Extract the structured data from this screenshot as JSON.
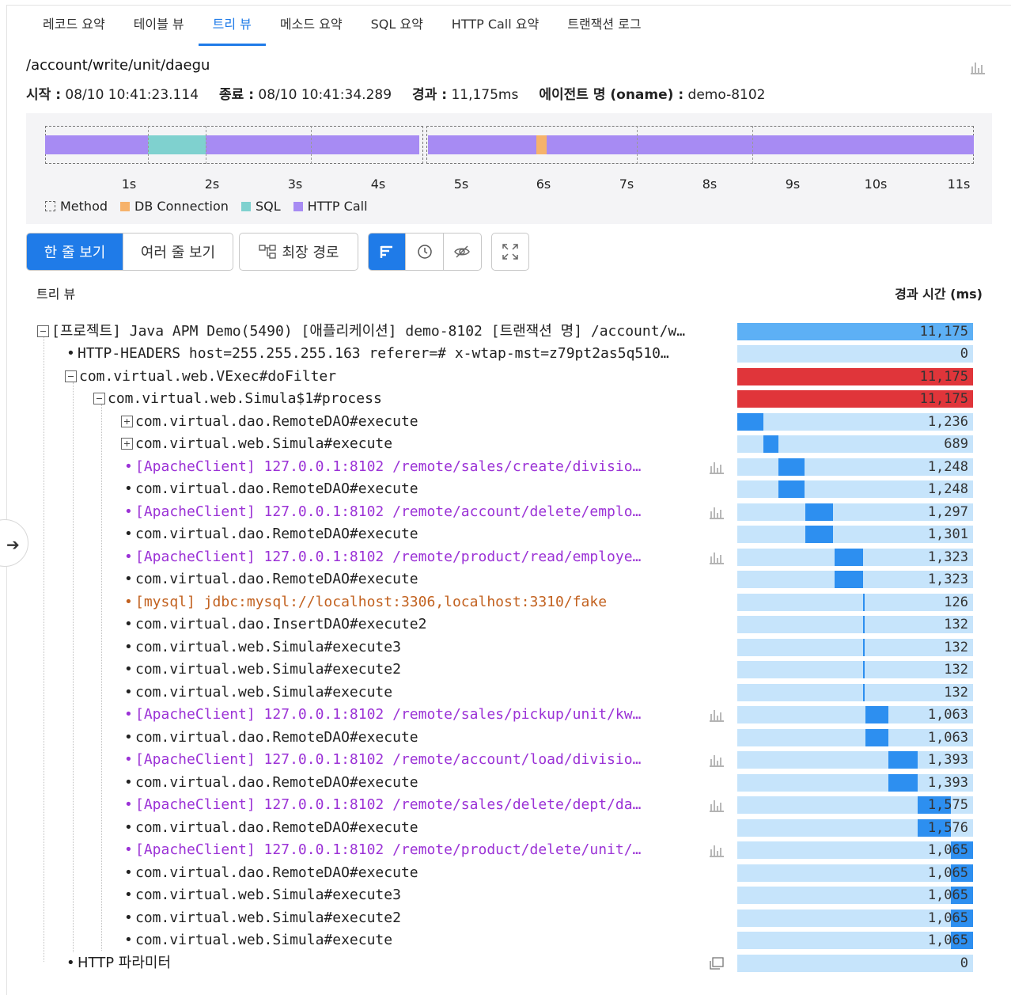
{
  "tabs": [
    "레코드 요약",
    "테이블 뷰",
    "트리 뷰",
    "메소드 요약",
    "SQL 요약",
    "HTTP Call 요약",
    "트랜잭션 로그"
  ],
  "active_tab": "트리 뷰",
  "url": "/account/write/unit/daegu",
  "meta": {
    "start_label": "시작 :",
    "start": "08/10 10:41:23.114",
    "end_label": "종료 :",
    "end": "08/10 10:41:34.289",
    "elapsed_label": "경과 :",
    "elapsed": "11,175ms",
    "agent_label": "에이전트 명 (oname) :",
    "agent": "demo-8102"
  },
  "timeline": {
    "ticks": [
      "1s",
      "2s",
      "3s",
      "4s",
      "5s",
      "6s",
      "7s",
      "8s",
      "9s",
      "10s",
      "11s"
    ],
    "legend": {
      "method": "Method",
      "db": "DB Connection",
      "sql": "SQL",
      "http": "HTTP Call"
    },
    "colors": {
      "http": "#a78bf3",
      "sql": "#7fd1cf",
      "db": "#f6b26b"
    }
  },
  "toolbar": {
    "single_line": "한 줄 보기",
    "multi_line": "여러 줄 보기",
    "longest_path": "최장 경로"
  },
  "tree_label": "트리 뷰",
  "elapsed_header": "경과 시간 (ms)",
  "rows": [
    {
      "text": "[프로젝트] Java APM Demo(5490) [애플리케이션] demo-8102 [트랜잭션 명] /account/w…",
      "value": "11,175"
    },
    {
      "text": "HTTP-HEADERS host=255.255.255.163 referer=# x-wtap-mst=z79pt2as5q510…",
      "value": "0"
    },
    {
      "text": "com.virtual.web.VExec#doFilter",
      "value": "11,175"
    },
    {
      "text": "com.virtual.web.Simula$1#process",
      "value": "11,175"
    },
    {
      "text": "com.virtual.dao.RemoteDAO#execute",
      "value": "1,236"
    },
    {
      "text": "com.virtual.web.Simula#execute",
      "value": "689"
    },
    {
      "text": "[ApacheClient] 127.0.0.1:8102 /remote/sales/create/divisio…",
      "value": "1,248"
    },
    {
      "text": "com.virtual.dao.RemoteDAO#execute",
      "value": "1,248"
    },
    {
      "text": "[ApacheClient] 127.0.0.1:8102 /remote/account/delete/emplo…",
      "value": "1,297"
    },
    {
      "text": "com.virtual.dao.RemoteDAO#execute",
      "value": "1,301"
    },
    {
      "text": "[ApacheClient] 127.0.0.1:8102 /remote/product/read/employe…",
      "value": "1,323"
    },
    {
      "text": "com.virtual.dao.RemoteDAO#execute",
      "value": "1,323"
    },
    {
      "text": "[mysql] jdbc:mysql://localhost:3306,localhost:3310/fake",
      "value": "126"
    },
    {
      "text": "com.virtual.dao.InsertDAO#execute2",
      "value": "132"
    },
    {
      "text": "com.virtual.web.Simula#execute3",
      "value": "132"
    },
    {
      "text": "com.virtual.web.Simula#execute2",
      "value": "132"
    },
    {
      "text": "com.virtual.web.Simula#execute",
      "value": "132"
    },
    {
      "text": "[ApacheClient] 127.0.0.1:8102 /remote/sales/pickup/unit/kw…",
      "value": "1,063"
    },
    {
      "text": "com.virtual.dao.RemoteDAO#execute",
      "value": "1,063"
    },
    {
      "text": "[ApacheClient] 127.0.0.1:8102 /remote/account/load/divisio…",
      "value": "1,393"
    },
    {
      "text": "com.virtual.dao.RemoteDAO#execute",
      "value": "1,393"
    },
    {
      "text": "[ApacheClient] 127.0.0.1:8102 /remote/sales/delete/dept/da…",
      "value": "1,575"
    },
    {
      "text": "com.virtual.dao.RemoteDAO#execute",
      "value": "1,576"
    },
    {
      "text": "[ApacheClient] 127.0.0.1:8102 /remote/product/delete/unit/…",
      "value": "1,065"
    },
    {
      "text": "com.virtual.dao.RemoteDAO#execute",
      "value": "1,065"
    },
    {
      "text": "com.virtual.web.Simula#execute3",
      "value": "1,065"
    },
    {
      "text": "com.virtual.web.Simula#execute2",
      "value": "1,065"
    },
    {
      "text": "com.virtual.web.Simula#execute",
      "value": "1,065"
    },
    {
      "text": "HTTP 파라미터",
      "value": "0"
    }
  ]
}
